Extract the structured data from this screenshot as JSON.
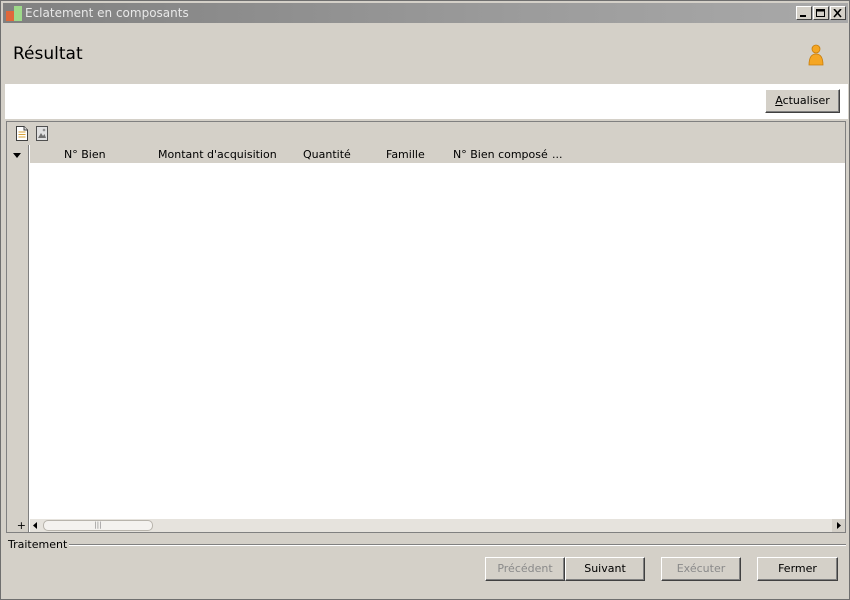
{
  "window": {
    "title": "Eclatement en composants"
  },
  "header": {
    "title": "Résultat"
  },
  "toolbar": {
    "refresh_label_accel": "A",
    "refresh_label_rest": "ctualiser"
  },
  "grid": {
    "columns": [
      "N° Bien",
      "Montant d'acquisition",
      "Quantité",
      "Famille",
      "N° Bien composé",
      "..."
    ],
    "rows": [],
    "add_row_symbol": "+",
    "scroll_thumb_grip": "|||"
  },
  "process_group": {
    "label": "Traitement"
  },
  "footer": {
    "previous_label": "Précédent",
    "next_label": "Suivant",
    "execute_label": "Exécuter",
    "close_label": "Fermer"
  },
  "colors": {
    "window_bg": "#d4d0c8",
    "title_gradient_start": "#808080",
    "user_icon": "#f5a623",
    "disabled_text": "#8a8a8a"
  },
  "icons": {
    "app": "app-icon",
    "user": "user-icon",
    "new_document": "new-document-icon",
    "export_image": "export-image-icon"
  }
}
